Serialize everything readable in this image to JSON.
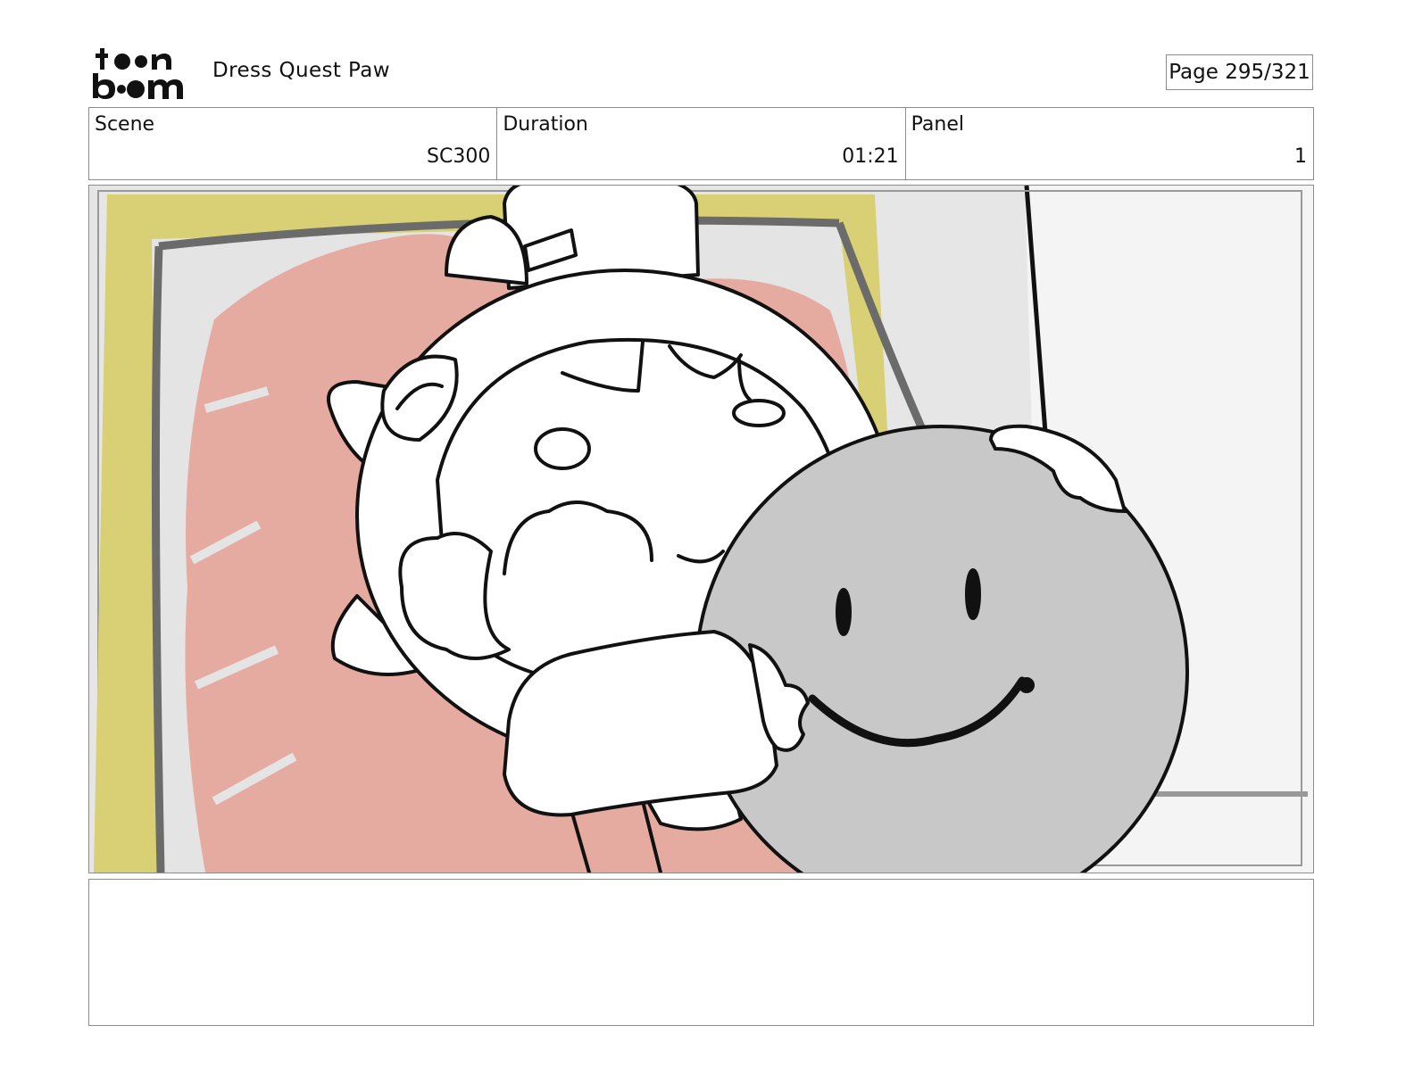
{
  "header": {
    "logo_text_top": "toon",
    "logo_text_bottom": "boom",
    "project_title": "Dress Quest Paw",
    "page_label": "Page 295/321"
  },
  "info": {
    "scene_label": "Scene",
    "scene_value": "SC300",
    "duration_label": "Duration",
    "duration_value": "01:21",
    "panel_label": "Panel",
    "panel_value": "1"
  },
  "panel": {
    "description": ""
  },
  "colors": {
    "border": "#8c8c8c",
    "frame_yellow": "#d9cf74",
    "painting_red": "#e5aba1",
    "ball_gray": "#c8c8c8",
    "wall_gray": "#e6e6e6"
  }
}
